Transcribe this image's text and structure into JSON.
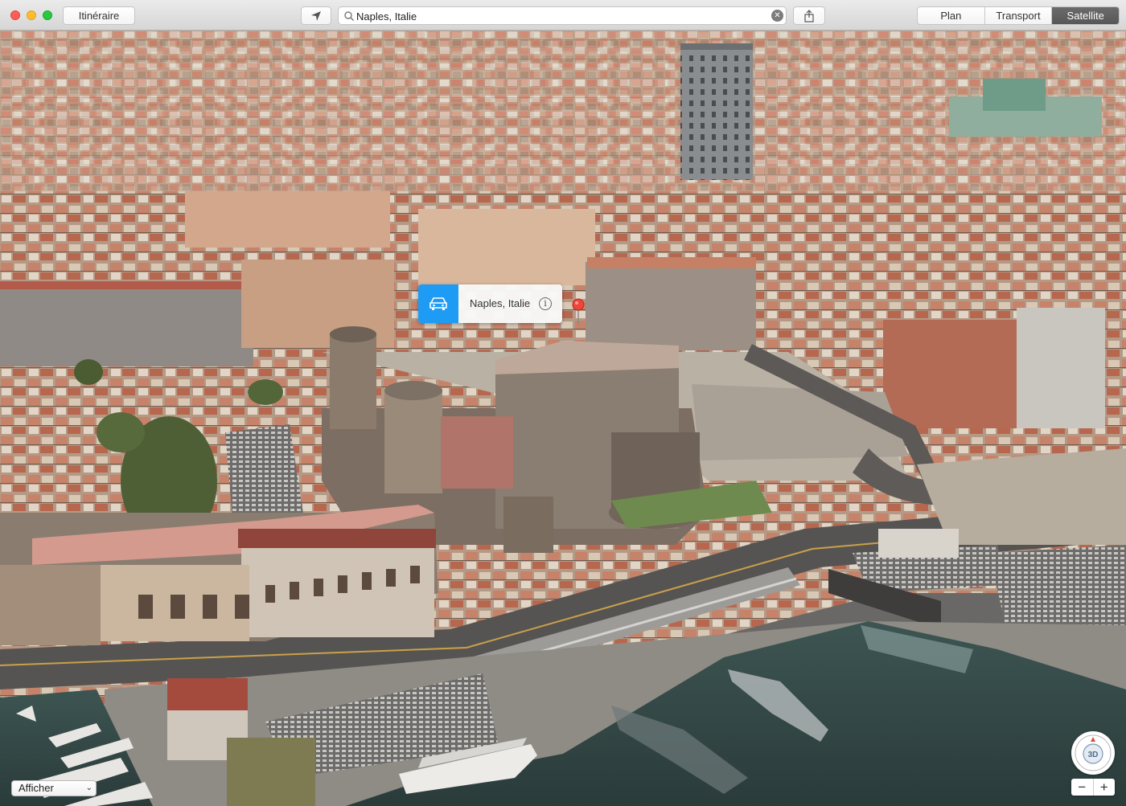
{
  "toolbar": {
    "route_button": "Itinéraire",
    "search_value": "Naples, Italie",
    "map_modes": [
      "Plan",
      "Transport",
      "Satellite"
    ],
    "active_mode": "Satellite"
  },
  "callout": {
    "title": "Naples, Italie",
    "accent_color": "#1e9cf5"
  },
  "bottom": {
    "show_menu": "Afficher",
    "compass_label": "3D",
    "zoom_out": "−",
    "zoom_in": "+"
  }
}
